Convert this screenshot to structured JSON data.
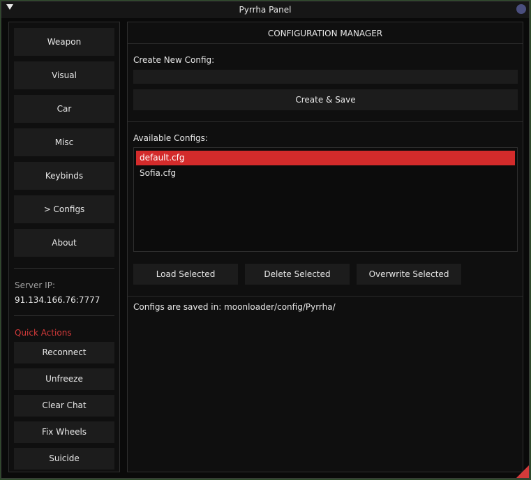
{
  "window": {
    "title": "Pyrrha Panel"
  },
  "colors": {
    "accent": "#d32b2b",
    "quick_actions_label": "#d33a3a",
    "close_dot": "#4a4e7e"
  },
  "sidebar": {
    "nav": [
      "Weapon",
      "Visual",
      "Car",
      "Misc",
      "Keybinds",
      "> Configs",
      "About"
    ],
    "server_ip_label": "Server IP:",
    "server_ip": "91.134.166.76:7777",
    "quick_actions_label": "Quick Actions",
    "quick_actions": [
      "Reconnect",
      "Unfreeze",
      "Clear Chat",
      "Fix Wheels",
      "Suicide"
    ]
  },
  "main": {
    "title": "CONFIGURATION MANAGER",
    "create_label": "Create New Config:",
    "create_input_value": "",
    "create_button": "Create & Save",
    "available_label": "Available Configs:",
    "configs": [
      {
        "name": "default.cfg",
        "selected": true
      },
      {
        "name": "Sofia.cfg",
        "selected": false
      }
    ],
    "actions": [
      "Load Selected",
      "Delete Selected",
      "Overwrite Selected"
    ],
    "footer": "Configs are saved in: moonloader/config/Pyrrha/"
  }
}
